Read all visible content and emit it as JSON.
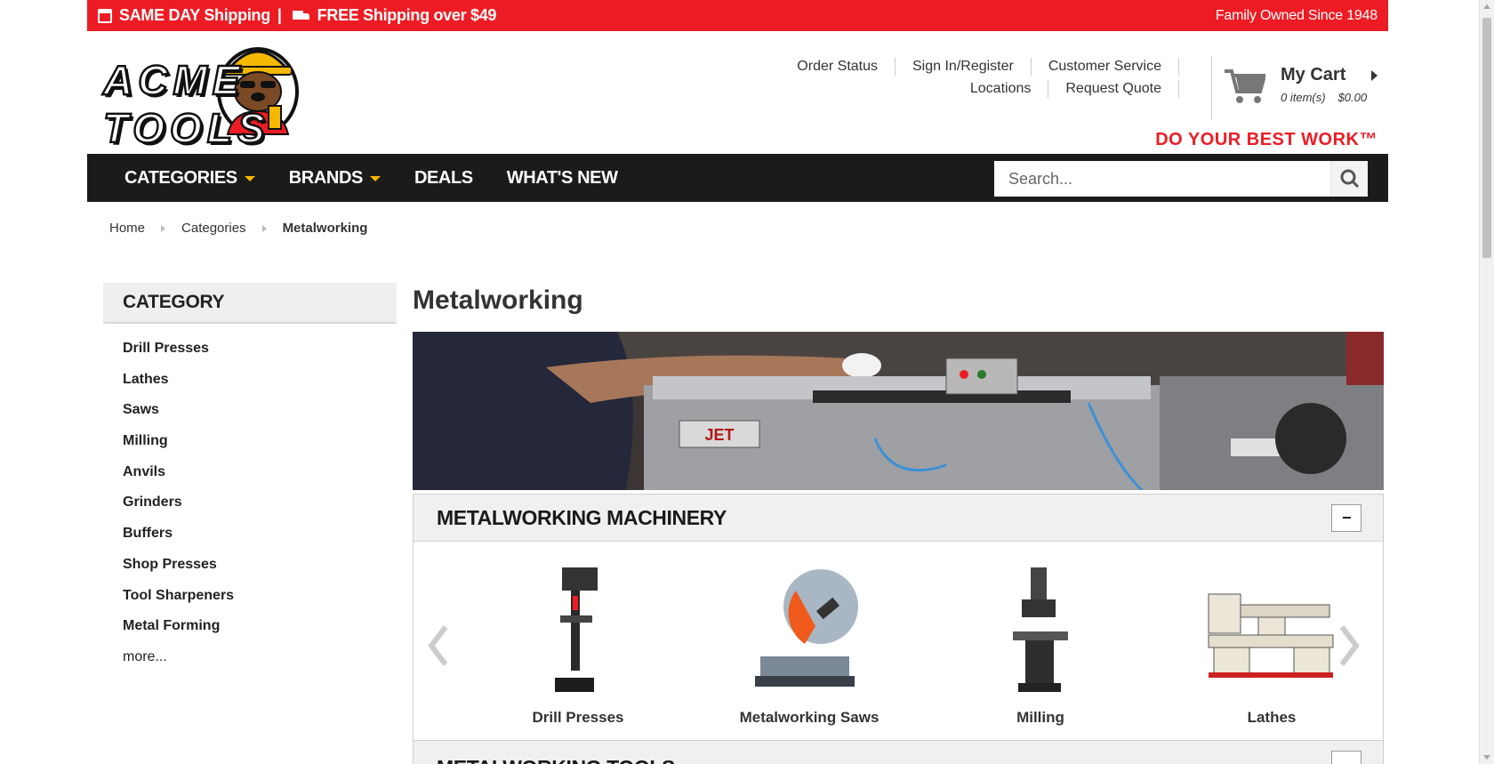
{
  "topbar": {
    "shipping_left": "SAME DAY Shipping",
    "shipping_right": "FREE Shipping over $49",
    "family": "Family Owned Since 1948"
  },
  "header": {
    "logo_text": "ACME TOOLS",
    "utility_row1": [
      "Order Status",
      "Sign In/Register",
      "Customer Service"
    ],
    "utility_row2": [
      "Locations",
      "Request Quote"
    ],
    "cart_title": "My Cart",
    "cart_items": "0 item(s)",
    "cart_total": "$0.00",
    "tagline": "DO YOUR BEST WORK™"
  },
  "nav": {
    "items": [
      "CATEGORIES",
      "BRANDS",
      "DEALS",
      "WHAT'S NEW"
    ],
    "search_placeholder": "Search..."
  },
  "breadcrumb": [
    "Home",
    "Categories",
    "Metalworking"
  ],
  "sidebar": {
    "title": "CATEGORY",
    "items": [
      "Drill Presses",
      "Lathes",
      "Saws",
      "Milling",
      "Anvils",
      "Grinders",
      "Buffers",
      "Shop Presses",
      "Tool Sharpeners",
      "Metal Forming"
    ],
    "more": "more..."
  },
  "main": {
    "title": "Metalworking",
    "hero_brand": "JET",
    "section1_title": "METALWORKING MACHINERY",
    "section1_toggle": "−",
    "products": [
      "Drill Presses",
      "Metalworking Saws",
      "Milling",
      "Lathes"
    ],
    "section2_title": "METALWORKING TOOLS"
  },
  "colors": {
    "brand_red": "#ed1c24",
    "nav_dark": "#1b1b1b",
    "accent_yellow": "#f5b800"
  }
}
